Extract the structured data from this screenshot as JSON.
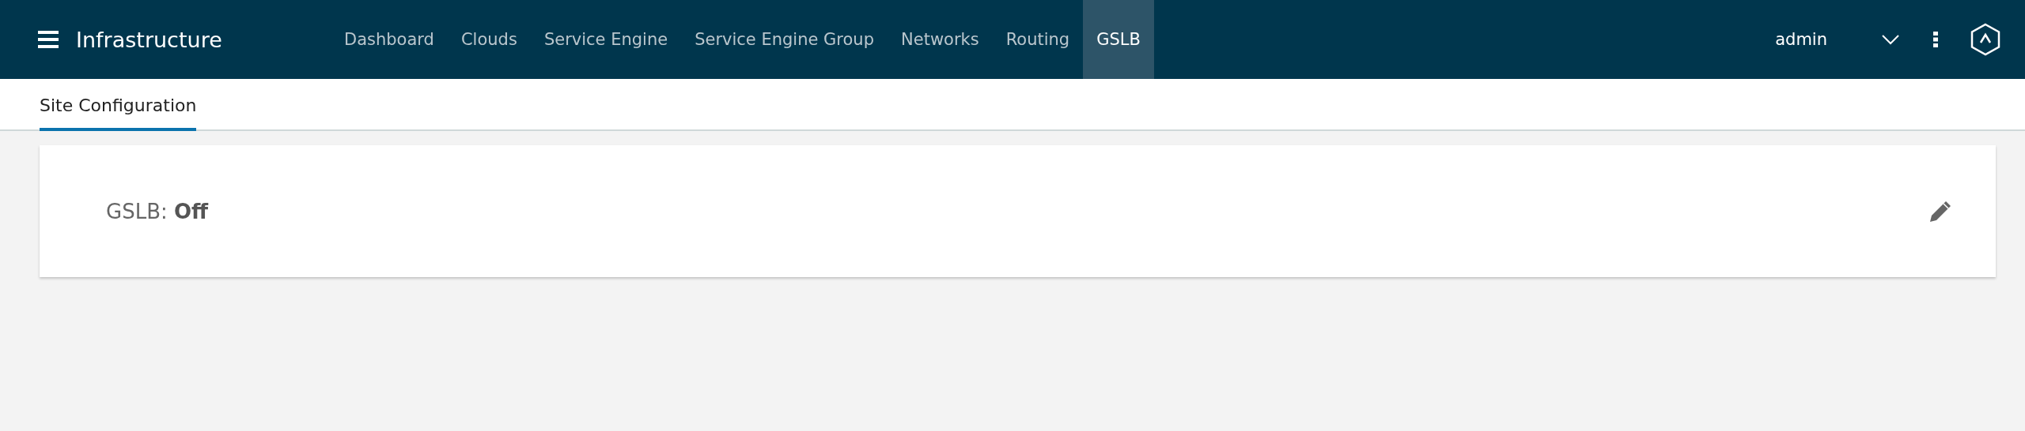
{
  "header": {
    "title": "Infrastructure",
    "nav": [
      {
        "label": "Dashboard",
        "selected": false
      },
      {
        "label": "Clouds",
        "selected": false
      },
      {
        "label": "Service Engine",
        "selected": false
      },
      {
        "label": "Service Engine Group",
        "selected": false
      },
      {
        "label": "Networks",
        "selected": false
      },
      {
        "label": "Routing",
        "selected": false
      },
      {
        "label": "GSLB",
        "selected": true
      }
    ],
    "user": "admin"
  },
  "tabs": [
    {
      "label": "Site Configuration",
      "selected": true
    }
  ],
  "card": {
    "label": "GSLB:",
    "value": "Off"
  }
}
